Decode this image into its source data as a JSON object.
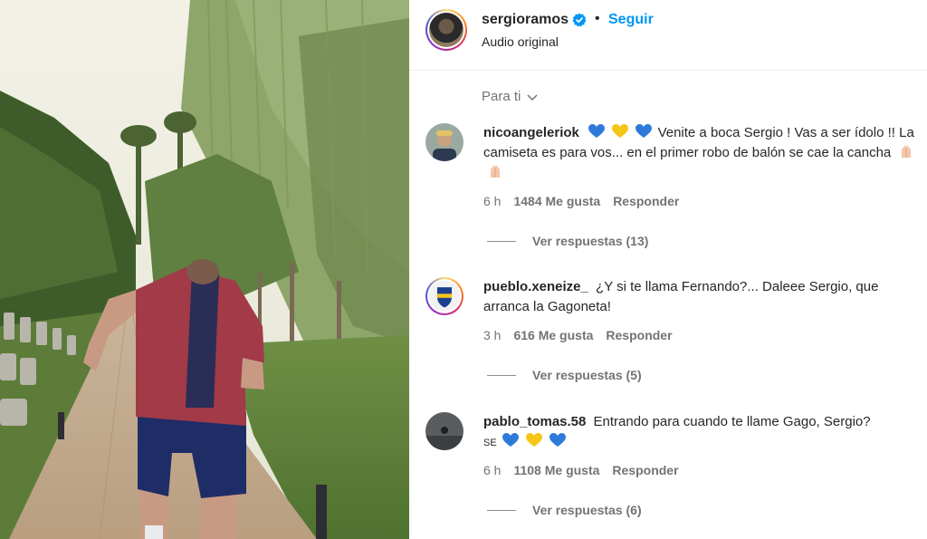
{
  "post": {
    "username": "sergioramos",
    "follow_label": "Seguir",
    "dot": "•",
    "audio": "Audio original",
    "colors": {
      "follow": "#0095f6",
      "verified": "#0095f6"
    }
  },
  "sort": {
    "label": "Para ti"
  },
  "comments": [
    {
      "username": "nicoangeleriok",
      "text_a": "Venite a boca Sergio ! Vas a ser ídolo !! La camiseta es para vos... en el primer robo de balón se cae la cancha",
      "time": "6 h",
      "likes": "1484 Me gusta",
      "reply": "Responder",
      "replies": "Ver respuestas (13)"
    },
    {
      "username": "pueblo.xeneize_",
      "text_a": "¿Y si te llama Fernando?... Daleee Sergio, que arranca la Gagoneta!",
      "time": "3 h",
      "likes": "616 Me gusta",
      "reply": "Responder",
      "replies": "Ver respuestas (5)"
    },
    {
      "username": "pablo_tomas.58",
      "text_a": "Entrando para cuando te llame Gago, Sergio?",
      "text_b": "SE",
      "time": "6 h",
      "likes": "1108 Me gusta",
      "reply": "Responder",
      "replies": "Ver respuestas (6)"
    }
  ]
}
